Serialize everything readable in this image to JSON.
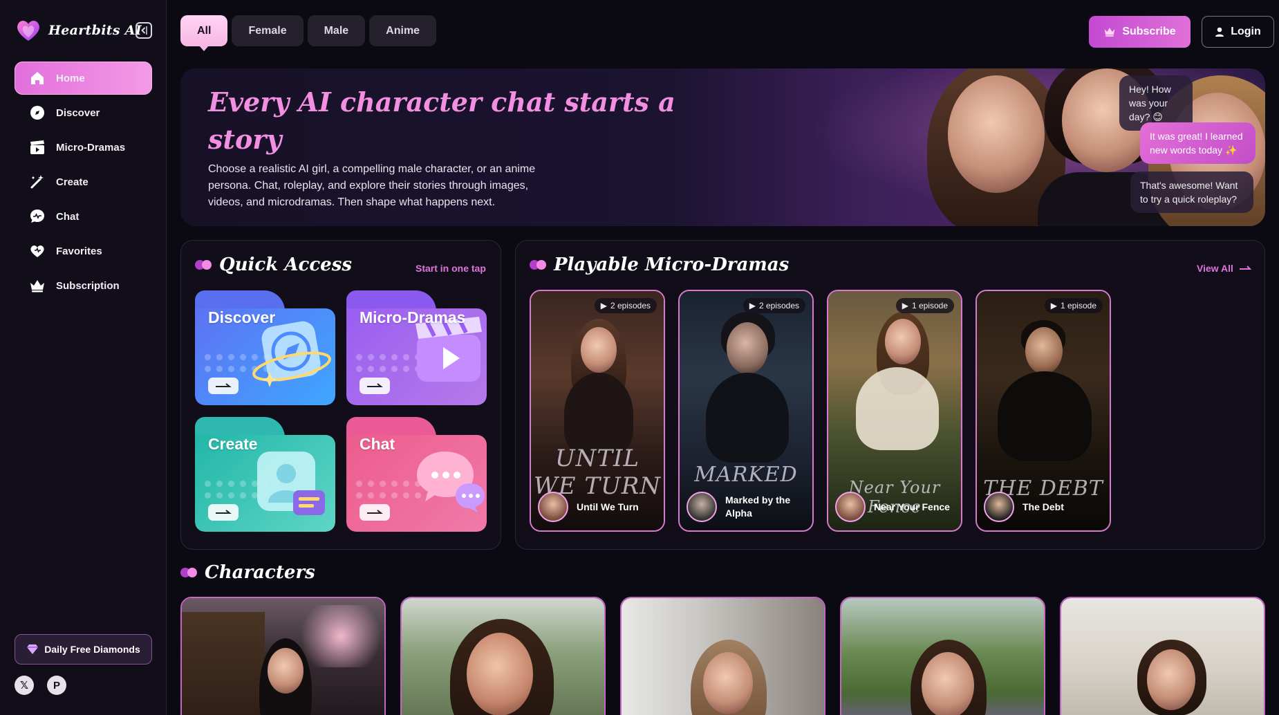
{
  "brand": {
    "name": "Heartbits AI"
  },
  "sidebar": {
    "items": [
      {
        "label": "Home",
        "icon": "home-icon",
        "active": true
      },
      {
        "label": "Discover",
        "icon": "compass-icon",
        "active": false
      },
      {
        "label": "Micro-Dramas",
        "icon": "clapperboard-icon",
        "active": false
      },
      {
        "label": "Create",
        "icon": "magic-wand-icon",
        "active": false
      },
      {
        "label": "Chat",
        "icon": "chat-bubble-icon",
        "active": false
      },
      {
        "label": "Favorites",
        "icon": "heart-icon",
        "active": false
      },
      {
        "label": "Subscription",
        "icon": "crown-icon",
        "active": false
      }
    ],
    "daily_diamonds_label": "Daily Free Diamonds",
    "socials": [
      {
        "icon": "x-icon",
        "glyph": "𝕏"
      },
      {
        "icon": "pinterest-icon",
        "glyph": "P"
      }
    ]
  },
  "topbar": {
    "tabs": [
      {
        "label": "All",
        "active": true
      },
      {
        "label": "Female",
        "active": false
      },
      {
        "label": "Male",
        "active": false
      },
      {
        "label": "Anime",
        "active": false
      }
    ],
    "subscribe_label": "Subscribe",
    "login_label": "Login"
  },
  "hero": {
    "title": "Every AI character chat starts a story",
    "description": "Choose a realistic AI girl, a compelling male character, or an anime persona. Chat, roleplay, and explore their stories through images, videos, and microdramas. Then shape what happens next.",
    "bubbles": [
      {
        "text": "Hey! How was your day? 😊",
        "style": "dark"
      },
      {
        "text": "It was great! I learned new words today ✨",
        "style": "pink"
      },
      {
        "text": "That's awesome! Want to try a quick roleplay?",
        "style": "dark"
      }
    ]
  },
  "quick_access": {
    "title": "Quick Access",
    "link": "Start in one tap",
    "cards": [
      {
        "label": "Discover",
        "icon": "compass-icon"
      },
      {
        "label": "Micro-Dramas",
        "icon": "clapperboard-icon"
      },
      {
        "label": "Create",
        "icon": "profile-card-icon"
      },
      {
        "label": "Chat",
        "icon": "chat-bubble-icon"
      }
    ]
  },
  "micro_dramas": {
    "title": "Playable Micro-Dramas",
    "link": "View All",
    "items": [
      {
        "title": "Until We Turn",
        "episodes": "2 episodes",
        "poster_text": "UNTIL WE TURN"
      },
      {
        "title": "Marked by the Alpha",
        "episodes": "2 episodes",
        "poster_text": "MARKED"
      },
      {
        "title": "Near Your Fence",
        "episodes": "1 episode",
        "poster_text": "Near Your Fence"
      },
      {
        "title": "The Debt",
        "episodes": "1 episode",
        "poster_text": "THE DEBT"
      }
    ]
  },
  "characters": {
    "title": "Characters"
  },
  "colors": {
    "accent": "#e26fdc",
    "accent_light": "#f49ae6",
    "bg": "#0b0912",
    "panel": "#110e19"
  }
}
